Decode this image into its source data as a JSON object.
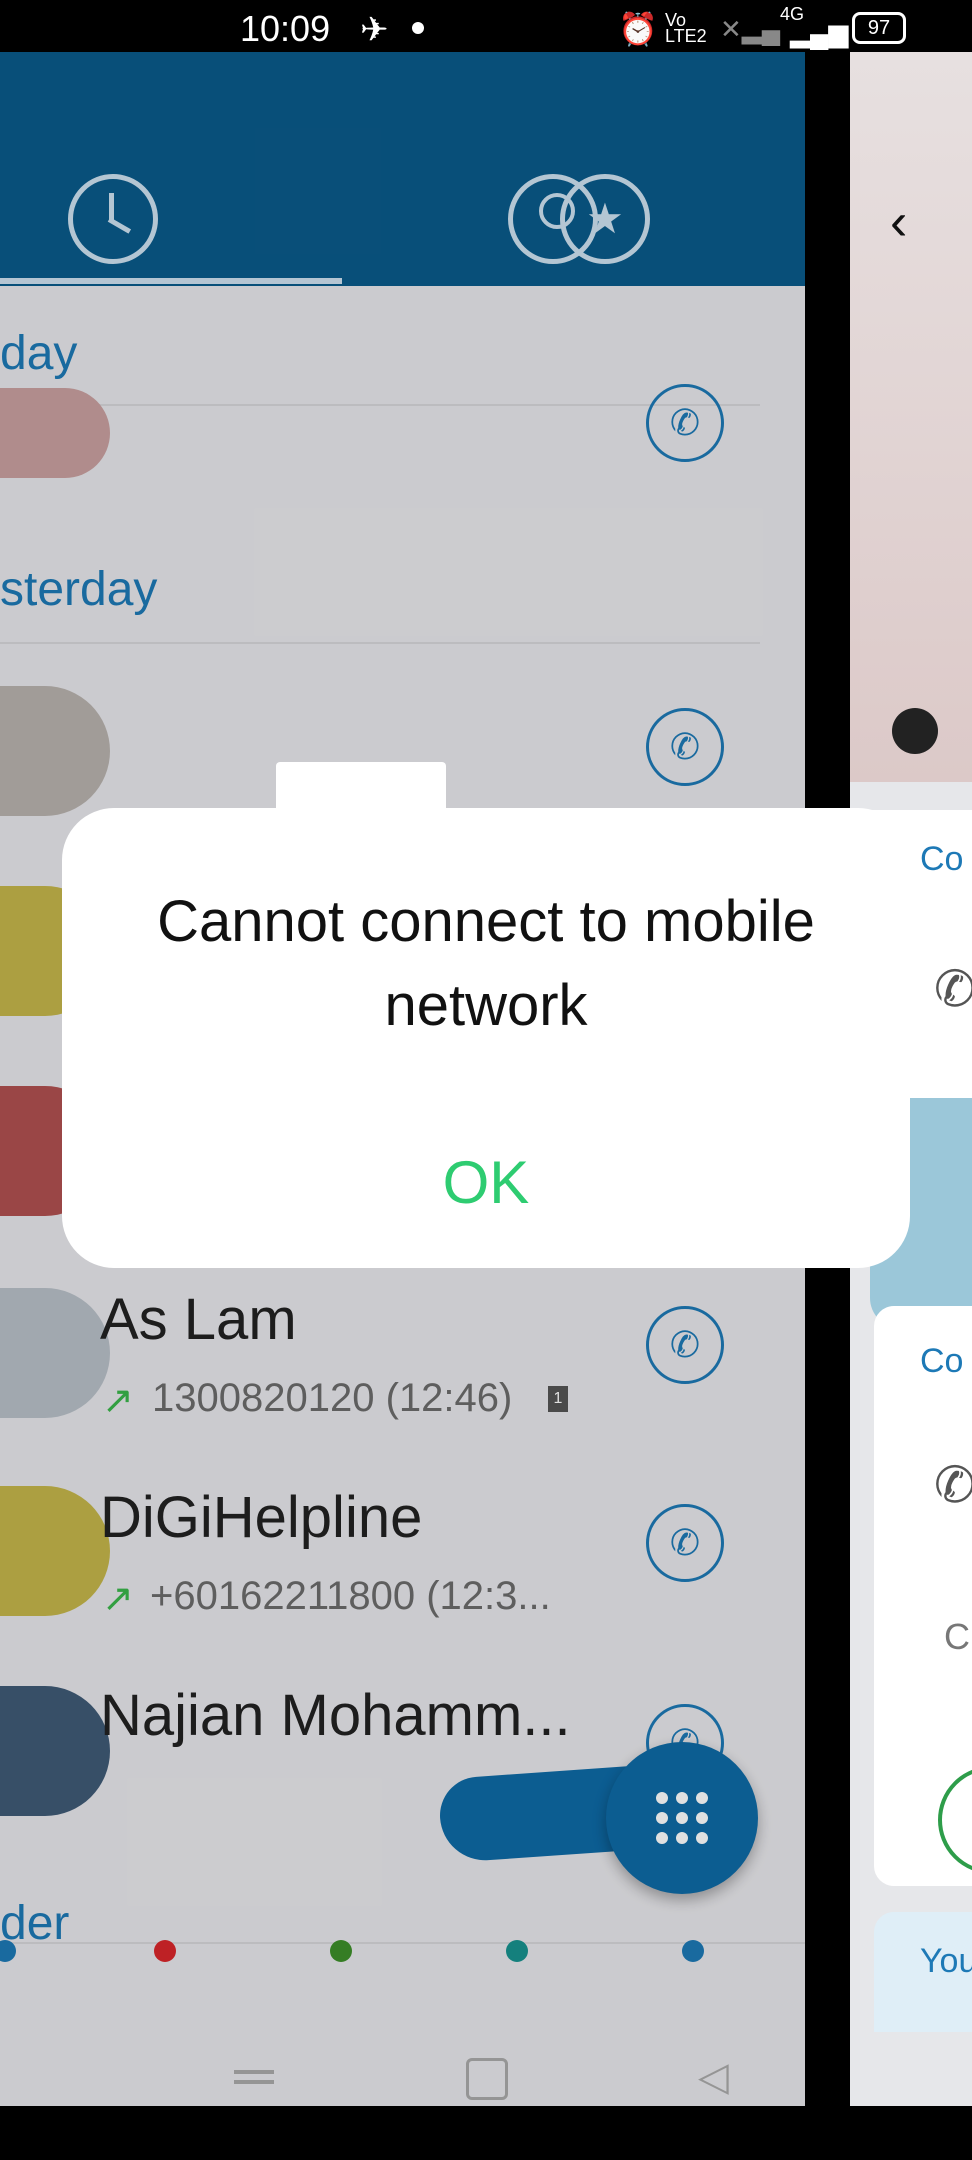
{
  "status_bar": {
    "time": "10:09",
    "network": "4G",
    "volte": "Vo LTE2",
    "battery": "97"
  },
  "tabs": [
    {
      "name": "recents",
      "icon": "clock-icon",
      "active": true
    },
    {
      "name": "contacts",
      "icon": "contacts-favorite-icon",
      "active": false
    }
  ],
  "sections": {
    "today": "day",
    "yesterday": "sterday",
    "older": "der"
  },
  "call_log": [
    {
      "name": "As Lam",
      "detail": "1300820120 (12:46)",
      "direction": "outgoing"
    },
    {
      "name": "DiGiHelpline",
      "detail": "+60162211800 (12:3...",
      "direction": "outgoing"
    },
    {
      "name": "Najian Mohamm...",
      "detail": "",
      "direction": "outgoing"
    }
  ],
  "dialog": {
    "message": "Cannot connect to mobile network",
    "ok_label": "OK"
  },
  "right_panel": {
    "label1": "Co",
    "label2": "Co",
    "label3": "C",
    "label4": "You"
  },
  "dock_dots": [
    "#1d79b6",
    "#d9262b",
    "#3d8f2a",
    "#17928f",
    "#1d79b6"
  ],
  "colors": {
    "accent": "#0a5a8a",
    "ok": "#2ecc71",
    "link": "#1d79b6"
  }
}
